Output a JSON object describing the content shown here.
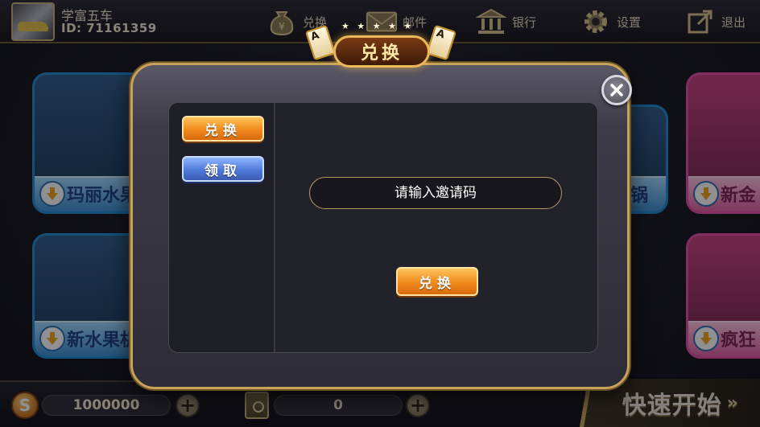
{
  "player": {
    "name": "学富五车",
    "id_label": "ID: 71161359"
  },
  "top_nav": [
    {
      "label": "兑换",
      "icon": "money-bag-icon"
    },
    {
      "label": "邮件",
      "icon": "mail-icon"
    },
    {
      "label": "银行",
      "icon": "bank-icon"
    },
    {
      "label": "设置",
      "icon": "gear-icon"
    },
    {
      "label": "退出",
      "icon": "exit-icon"
    }
  ],
  "game_tiles": {
    "left_top": "玛丽水果机",
    "left_bottom": "新水果机",
    "mid_right_top": "火锅",
    "right_top": "新金",
    "right_bottom": "疯狂"
  },
  "dialog": {
    "title": "兑换",
    "side_tabs": [
      {
        "label": "兑换",
        "active": true
      },
      {
        "label": "领取",
        "active": false
      }
    ],
    "input_placeholder": "请输入邀请码",
    "submit_label": "兑换",
    "badge_card_letter": "A"
  },
  "bottom_bar": {
    "coins": "1000000",
    "bank_value": "0",
    "quick_start": "快速开始"
  },
  "colors": {
    "accent_gold": "#c9a25a",
    "button_orange": "#f08a1c",
    "button_blue": "#4f7ad8"
  }
}
